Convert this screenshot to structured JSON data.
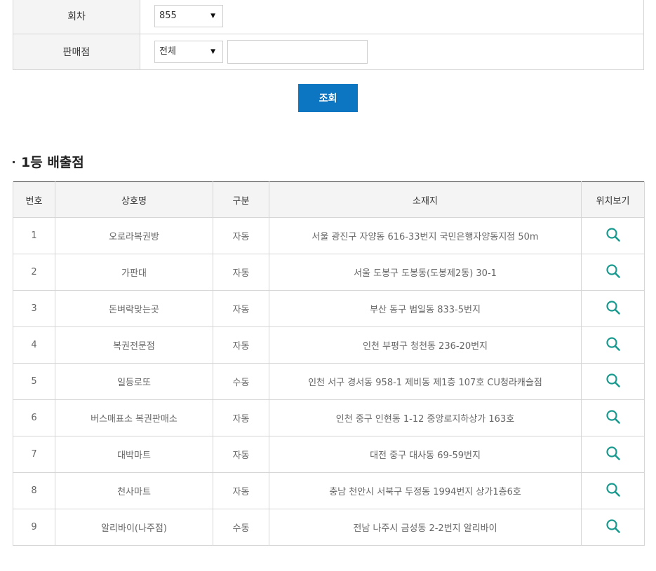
{
  "form": {
    "round_label": "회차",
    "round_value": "855",
    "store_label": "판매점",
    "store_filter_value": "전체",
    "store_search_value": "",
    "search_button": "조회",
    "dropdown_arrow": "▼"
  },
  "section": {
    "title": "1등 배출점"
  },
  "table": {
    "headers": [
      "번호",
      "상호명",
      "구분",
      "소재지",
      "위치보기"
    ],
    "rows": [
      {
        "no": "1",
        "name": "오로라복권방",
        "type": "자동",
        "address": "서울 광진구 자양동 616-33번지 국민은행자양동지점 50m"
      },
      {
        "no": "2",
        "name": "가판대",
        "type": "자동",
        "address": "서울 도봉구 도봉동(도봉제2동) 30-1"
      },
      {
        "no": "3",
        "name": "돈벼락맞는곳",
        "type": "자동",
        "address": "부산 동구 범일동 833-5번지"
      },
      {
        "no": "4",
        "name": "복권전문점",
        "type": "자동",
        "address": "인천 부평구 청천동 236-20번지"
      },
      {
        "no": "5",
        "name": "일등로또",
        "type": "수동",
        "address": "인천 서구 경서동 958-1 제비동 제1층 107호 CU청라캐슬점"
      },
      {
        "no": "6",
        "name": "버스매표소 복권판매소",
        "type": "자동",
        "address": "인천 중구 인현동 1-12 중앙로지하상가 163호"
      },
      {
        "no": "7",
        "name": "대박마트",
        "type": "자동",
        "address": "대전 중구 대사동 69-59번지"
      },
      {
        "no": "8",
        "name": "천사마트",
        "type": "자동",
        "address": "충남 천안시 서북구 두정동 1994번지 상가1층6호"
      },
      {
        "no": "9",
        "name": "알리바이(나주점)",
        "type": "수동",
        "address": "전남 나주시 금성동 2-2번지 알리바이"
      }
    ]
  },
  "colors": {
    "button_blue": "#0d76c2",
    "icon_teal": "#1a9a8f",
    "header_bg": "#f4f4f4"
  },
  "icons": {
    "location": "magnifier-icon"
  }
}
